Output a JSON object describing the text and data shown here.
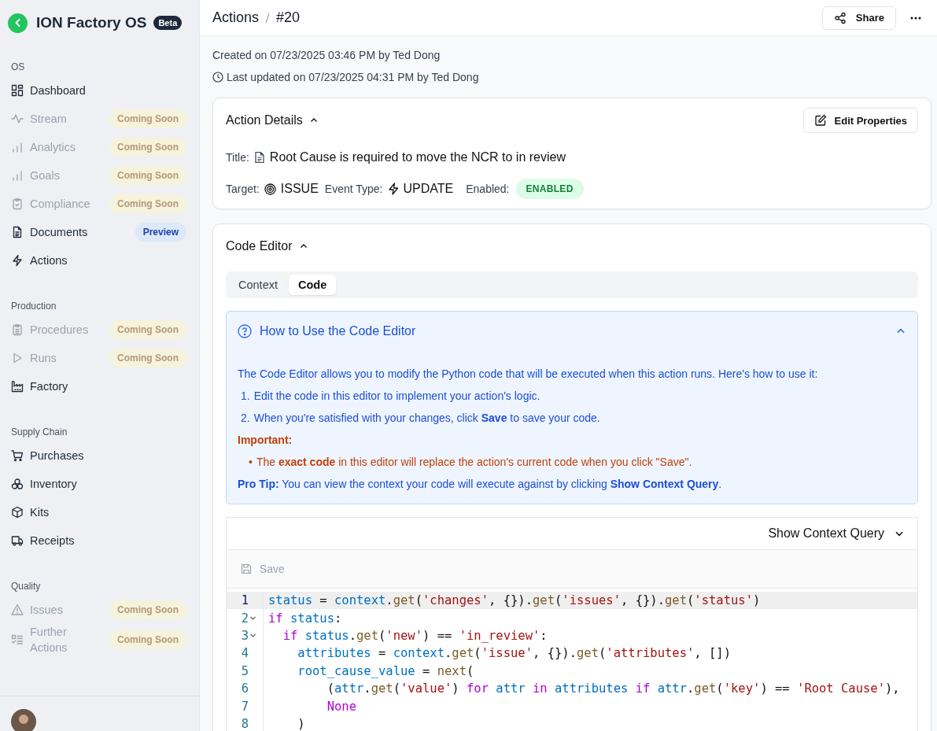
{
  "sidebar": {
    "app_name": "ION Factory OS",
    "badge": "Beta",
    "sections": [
      {
        "title": "OS",
        "items": [
          {
            "label": "Dashboard",
            "disabled": false
          },
          {
            "label": "Stream",
            "disabled": true,
            "badge": {
              "text": "Coming Soon",
              "kind": "soon"
            }
          },
          {
            "label": "Analytics",
            "disabled": true,
            "badge": {
              "text": "Coming Soon",
              "kind": "soon"
            }
          },
          {
            "label": "Goals",
            "disabled": true,
            "badge": {
              "text": "Coming Soon",
              "kind": "soon"
            }
          },
          {
            "label": "Compliance",
            "disabled": true,
            "badge": {
              "text": "Coming Soon",
              "kind": "soon"
            }
          },
          {
            "label": "Documents",
            "disabled": false,
            "badge": {
              "text": "Preview",
              "kind": "preview"
            }
          },
          {
            "label": "Actions",
            "disabled": false
          }
        ]
      },
      {
        "title": "Production",
        "items": [
          {
            "label": "Procedures",
            "disabled": true,
            "badge": {
              "text": "Coming Soon",
              "kind": "soon"
            }
          },
          {
            "label": "Runs",
            "disabled": true,
            "badge": {
              "text": "Coming Soon",
              "kind": "soon"
            }
          },
          {
            "label": "Factory",
            "disabled": false
          }
        ]
      },
      {
        "title": "Supply Chain",
        "items": [
          {
            "label": "Purchases",
            "disabled": false
          },
          {
            "label": "Inventory",
            "disabled": false
          },
          {
            "label": "Kits",
            "disabled": false
          },
          {
            "label": "Receipts",
            "disabled": false
          }
        ]
      },
      {
        "title": "Quality",
        "items": [
          {
            "label": "Issues",
            "disabled": true,
            "badge": {
              "text": "Coming Soon",
              "kind": "soon"
            }
          },
          {
            "label": "Further Actions",
            "disabled": true,
            "badge": {
              "text": "Coming Soon",
              "kind": "soon"
            }
          }
        ]
      }
    ]
  },
  "header": {
    "breadcrumb": [
      "Actions",
      "#20"
    ],
    "share_button": "Share"
  },
  "meta": {
    "created": "Created on 07/23/2025 03:46 PM by Ted Dong",
    "updated": "Last updated on 07/23/2025 04:31 PM by Ted Dong"
  },
  "action_details": {
    "title": "Action Details",
    "expanded": true,
    "edit_button": "Edit Properties",
    "title_label": "Title:",
    "title_value": "Root Cause is required to move the NCR to in review",
    "target_label": "Target:",
    "target_value": "ISSUE",
    "event_label": "Event Type:",
    "event_value": "UPDATE",
    "enabled_label": "Enabled:",
    "enabled_value": "ENABLED",
    "enabled": true
  },
  "code_editor": {
    "title": "Code Editor",
    "expanded": true,
    "tabs": [
      {
        "label": "Context",
        "selected": false
      },
      {
        "label": "Code",
        "selected": true
      }
    ],
    "help": {
      "title": "How to Use the Code Editor",
      "expanded": true,
      "intro": "The Code Editor allows you to modify the Python code that will be executed when this action runs. Here's how to use it:",
      "steps": [
        {
          "number": "1.",
          "text": "Edit the code in this editor to implement your action's logic."
        },
        {
          "number": "2.",
          "text": "When you're satisfied with your changes, click **Save** to save your code."
        }
      ],
      "important_label": "Important:",
      "warnings": [
        {
          "bullet": "•",
          "text": "The **exact code** in this editor will replace the action's current code when you click \"Save\"."
        }
      ],
      "tip": "**Pro Tip:** You can view the context your code will execute against by clicking **Show Context Query**."
    },
    "query_toggle": {
      "label": "Show Context Query",
      "expanded": false
    },
    "save_button": {
      "label": "Save",
      "disabled": true
    },
    "lines": [
      {
        "number": "1",
        "active": true,
        "fold": false,
        "tokens": [
          {
            "kind": "var",
            "text": "status"
          },
          {
            "kind": "p",
            "text": " = "
          },
          {
            "kind": "var",
            "text": "context"
          },
          {
            "kind": "p",
            "text": "."
          },
          {
            "kind": "fn",
            "text": "get"
          },
          {
            "kind": "p",
            "text": "("
          },
          {
            "kind": "str",
            "text": "'changes'"
          },
          {
            "kind": "p",
            "text": ", {})."
          },
          {
            "kind": "fn",
            "text": "get"
          },
          {
            "kind": "p",
            "text": "("
          },
          {
            "kind": "str",
            "text": "'issues'"
          },
          {
            "kind": "p",
            "text": ", {})."
          },
          {
            "kind": "fn",
            "text": "get"
          },
          {
            "kind": "p",
            "text": "("
          },
          {
            "kind": "str",
            "text": "'status'"
          },
          {
            "kind": "p",
            "text": ")"
          }
        ]
      },
      {
        "number": "2",
        "active": false,
        "fold": true,
        "tokens": [
          {
            "kind": "kw",
            "text": "if"
          },
          {
            "kind": "var",
            "text": " status"
          },
          {
            "kind": "p",
            "text": ":"
          }
        ]
      },
      {
        "number": "3",
        "active": false,
        "fold": true,
        "tokens": [
          {
            "kind": "kw",
            "text": "  if"
          },
          {
            "kind": "var",
            "text": " status"
          },
          {
            "kind": "p",
            "text": "."
          },
          {
            "kind": "fn",
            "text": "get"
          },
          {
            "kind": "p",
            "text": "("
          },
          {
            "kind": "str",
            "text": "'new'"
          },
          {
            "kind": "p",
            "text": ") == "
          },
          {
            "kind": "str",
            "text": "'in_review'"
          },
          {
            "kind": "p",
            "text": ":"
          }
        ]
      },
      {
        "number": "4",
        "active": false,
        "fold": false,
        "tokens": [
          {
            "kind": "var",
            "text": "    attributes"
          },
          {
            "kind": "p",
            "text": " = "
          },
          {
            "kind": "var",
            "text": "context"
          },
          {
            "kind": "p",
            "text": "."
          },
          {
            "kind": "fn",
            "text": "get"
          },
          {
            "kind": "p",
            "text": "("
          },
          {
            "kind": "str",
            "text": "'issue'"
          },
          {
            "kind": "p",
            "text": ", {})."
          },
          {
            "kind": "fn",
            "text": "get"
          },
          {
            "kind": "p",
            "text": "("
          },
          {
            "kind": "str",
            "text": "'attributes'"
          },
          {
            "kind": "p",
            "text": ", [])"
          }
        ]
      },
      {
        "number": "5",
        "active": false,
        "fold": false,
        "tokens": [
          {
            "kind": "var",
            "text": "    root_cause_value"
          },
          {
            "kind": "p",
            "text": " = "
          },
          {
            "kind": "fn",
            "text": "next"
          },
          {
            "kind": "p",
            "text": "("
          }
        ]
      },
      {
        "number": "6",
        "active": false,
        "fold": false,
        "tokens": [
          {
            "kind": "p",
            "text": "        ("
          },
          {
            "kind": "var",
            "text": "attr"
          },
          {
            "kind": "p",
            "text": "."
          },
          {
            "kind": "fn",
            "text": "get"
          },
          {
            "kind": "p",
            "text": "("
          },
          {
            "kind": "str",
            "text": "'value'"
          },
          {
            "kind": "p",
            "text": ") "
          },
          {
            "kind": "kw",
            "text": "for"
          },
          {
            "kind": "var",
            "text": " attr"
          },
          {
            "kind": "kw",
            "text": " in"
          },
          {
            "kind": "var",
            "text": " attributes"
          },
          {
            "kind": "kw",
            "text": " if"
          },
          {
            "kind": "var",
            "text": " attr"
          },
          {
            "kind": "p",
            "text": "."
          },
          {
            "kind": "fn",
            "text": "get"
          },
          {
            "kind": "p",
            "text": "("
          },
          {
            "kind": "str",
            "text": "'key'"
          },
          {
            "kind": "p",
            "text": ") == "
          },
          {
            "kind": "str",
            "text": "'Root Cause'"
          },
          {
            "kind": "p",
            "text": "),"
          }
        ]
      },
      {
        "number": "7",
        "active": false,
        "fold": false,
        "tokens": [
          {
            "kind": "kw",
            "text": "        None"
          }
        ]
      },
      {
        "number": "8",
        "active": false,
        "fold": false,
        "tokens": [
          {
            "kind": "p",
            "text": "    )"
          }
        ]
      }
    ]
  }
}
